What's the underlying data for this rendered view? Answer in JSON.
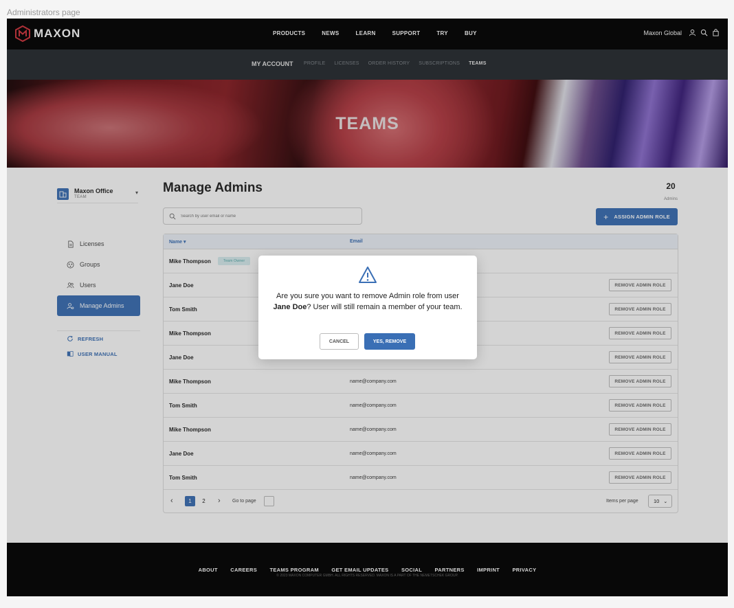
{
  "frame_label": "Administrators page",
  "topnav": {
    "logo_text": "MAXON",
    "links": [
      "PRODUCTS",
      "NEWS",
      "LEARN",
      "SUPPORT",
      "TRY",
      "BUY"
    ],
    "region": "Maxon Global"
  },
  "account_nav": {
    "title": "MY ACCOUNT",
    "links": [
      "PROFILE",
      "LICENSES",
      "ORDER HISTORY",
      "SUBSCRIPTIONS",
      "TEAMS"
    ],
    "active": "TEAMS"
  },
  "hero": {
    "title": "TEAMS"
  },
  "sidebar": {
    "team_name": "Maxon Office",
    "team_sub": "TEAM",
    "items": [
      {
        "label": "Licenses",
        "icon": "document-icon"
      },
      {
        "label": "Groups",
        "icon": "groups-icon"
      },
      {
        "label": "Users",
        "icon": "users-icon"
      },
      {
        "label": "Manage Admins",
        "icon": "admin-icon",
        "active": true
      }
    ],
    "refresh_label": "REFRESH",
    "manual_label": "USER MANUAL"
  },
  "main": {
    "title": "Manage Admins",
    "count": "20",
    "count_label": "Admins",
    "search_placeholder": "Search by user email or name",
    "assign_label": "ASSIGN ADMIN ROLE",
    "columns": {
      "name": "Name",
      "email": "Email"
    },
    "rows": [
      {
        "name": "Mike Thompson",
        "email": "",
        "tag": "Team Owner",
        "action": ""
      },
      {
        "name": "Jane Doe",
        "email": "",
        "tag": "",
        "action": "REMOVE ADMIN ROLE"
      },
      {
        "name": "Tom Smith",
        "email": "",
        "tag": "",
        "action": "REMOVE ADMIN ROLE"
      },
      {
        "name": "Mike Thompson",
        "email": "",
        "tag": "",
        "action": "REMOVE ADMIN ROLE"
      },
      {
        "name": "Jane Doe",
        "email": "",
        "tag": "",
        "action": "REMOVE ADMIN ROLE"
      },
      {
        "name": "Mike Thompson",
        "email": "name@company.com",
        "tag": "",
        "action": "REMOVE ADMIN ROLE"
      },
      {
        "name": "Tom Smith",
        "email": "name@company.com",
        "tag": "",
        "action": "REMOVE ADMIN ROLE"
      },
      {
        "name": "Mike Thompson",
        "email": "name@company.com",
        "tag": "",
        "action": "REMOVE ADMIN ROLE"
      },
      {
        "name": "Jane Doe",
        "email": "name@company.com",
        "tag": "",
        "action": "REMOVE ADMIN ROLE"
      },
      {
        "name": "Tom Smith",
        "email": "name@company.com",
        "tag": "",
        "action": "REMOVE ADMIN ROLE"
      }
    ],
    "pagination": {
      "pages": [
        "1",
        "2"
      ],
      "current": "1",
      "goto_label": "Go to page",
      "items_per_page_label": "Items per page",
      "items_per_page": "10"
    }
  },
  "modal": {
    "message_pre": "Are you sure you want to remove Admin role from user ",
    "message_user": "Jane Doe",
    "message_post": "? User will still remain a member of your team.",
    "cancel_label": "CANCEL",
    "confirm_label": "YES, REMOVE"
  },
  "footer": {
    "links": [
      "ABOUT",
      "CAREERS",
      "TEAMS PROGRAM",
      "GET EMAIL UPDATES",
      "SOCIAL",
      "PARTNERS",
      "IMPRINT",
      "PRIVACY"
    ],
    "copyright": "© 2023 MAXON COMPUTER GMBH. ALL RIGHTS RESERVED. MAXON IS A PART OF THE NEMETSCHEK GROUP."
  },
  "colors": {
    "accent": "#3a6fb5",
    "nav_bg": "#000000",
    "subnav_bg": "#262b30"
  }
}
